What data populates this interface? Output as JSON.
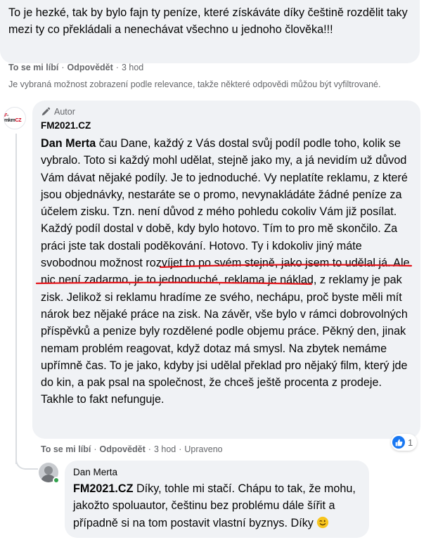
{
  "comment1": {
    "text": "To je hezké, tak by bylo fajn ty peníze, které získáváte díky češtině rozdělit taky mezi ty co překládali a nenechávat všechno u jednoho člověka!!!",
    "actions": {
      "like": "To se mi líbí",
      "reply": "Odpovědět",
      "time": "3 hod"
    }
  },
  "relevance_notice": "Je vybraná možnost zobrazení podle relevance, takže některé odpovědi můžou být vyfiltrované.",
  "reply1": {
    "avatar_label": "F-mkmCZ",
    "badge": "Autor",
    "page_name": "FM2021.CZ",
    "mention": "Dan Merta",
    "text_before": " čau Dane, každý z Vás dostal svůj podíl podle toho, kolik se vybralo. Toto si každý mohl udělat, stejně jako my, a já nevidím už důvod Vám dávat nějaké podíly. Je to jednoduché. Vy neplatíte reklamu, z které jsou objednávky, nestaráte se o promo, nevynakládáte žádné peníze za účelem zisku. Tzn. není důvod z mého pohledu cokoliv Vám již posílat. Každý podíl dostal v době, kdy bylo hotovo. Tím to pro mě skončilo. Za práci jste tak dostali poděkování. Hotovo. ",
    "text_highlight": "Ty i kdokoliv jiný máte svobodnou možnost rozvíjet to po svém stejně, jako jsem to udělal já.",
    "text_after": " Ale nic není zadarmo, je to jednoduché, reklama je náklad, z reklamy je pak zisk. Jelikož si reklamu hradíme ze svého, nechápu, proč byste měli mít nárok bez nějaké práce na zisk. Na závěr, vše bylo v rámci dobrovolných příspěvků a penize byly rozdělené podle objemu práce. Pěkný den, jinak nemam problém reagovat, když dotaz má smysl. Na zbytek nemáme upřímně čas. To je jako, kdyby jsi udělal překlad pro nějaký film, který jde do kin, a pak psal na společnost, že chceš ještě procenta z prodeje. Takhle to fakt nefunguje.",
    "actions": {
      "like": "To se mi líbí",
      "reply": "Odpovědět",
      "time": "3 hod",
      "edited": "Upraveno"
    },
    "reaction_count": "1",
    "colors": {
      "underline": "#e4161c",
      "like": "#1877f2"
    }
  },
  "reply2": {
    "author": "Dan Merta",
    "mention": "FM2021.CZ",
    "text": " Díky, tohle mi stačí. Chápu to tak, že mohu, jakožto spoluautor, češtinu bez problému dále šířit a případně si na tom postavit vlastní byznys. Díky",
    "emoji": "wink-emoji"
  }
}
